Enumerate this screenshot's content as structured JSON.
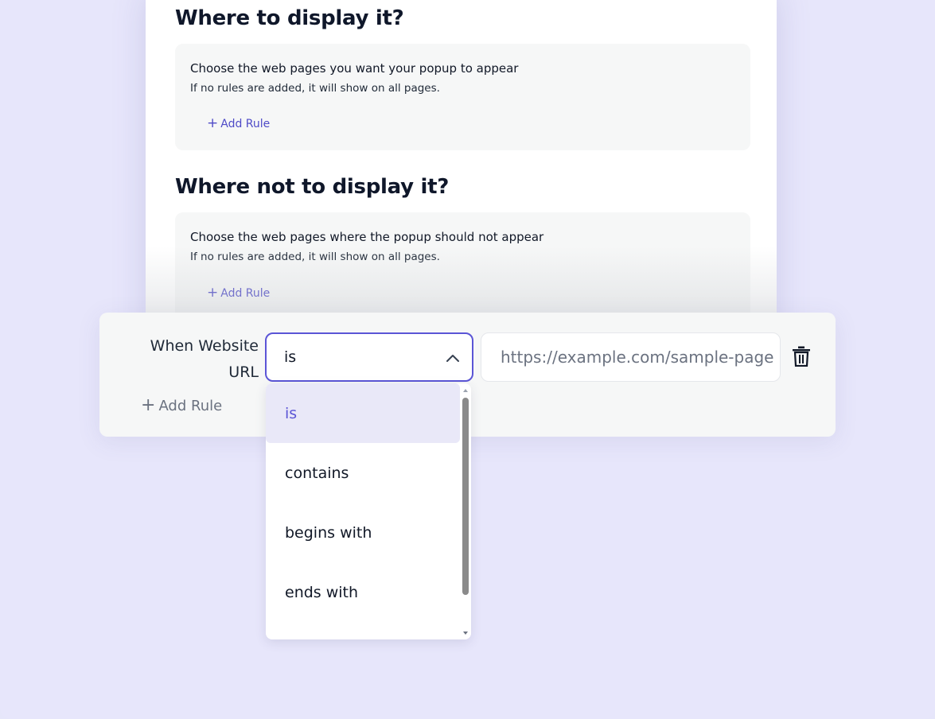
{
  "section_display": {
    "title": "Where to display it?",
    "heading": "Choose the web pages you want your popup to appear",
    "subtext": "If no rules are added, it will show on all pages.",
    "add_rule": "Add Rule"
  },
  "section_not_display": {
    "title": "Where not to display it?",
    "heading": "Choose the web pages where the popup should not appear",
    "subtext": "If no rules are added, it will show on all pages.",
    "add_rule": "Add Rule"
  },
  "rule_row": {
    "label": "When Website URL",
    "condition_selected": "is",
    "url_placeholder": "https://example.com/sample-page",
    "add_rule": "Add Rule"
  },
  "dropdown": {
    "options": [
      "is",
      "contains",
      "begins with",
      "ends with"
    ],
    "selected_index": 0
  },
  "colors": {
    "accent": "#5b55d6",
    "background": "#e7e6fb",
    "panel": "#f6f7f7"
  }
}
